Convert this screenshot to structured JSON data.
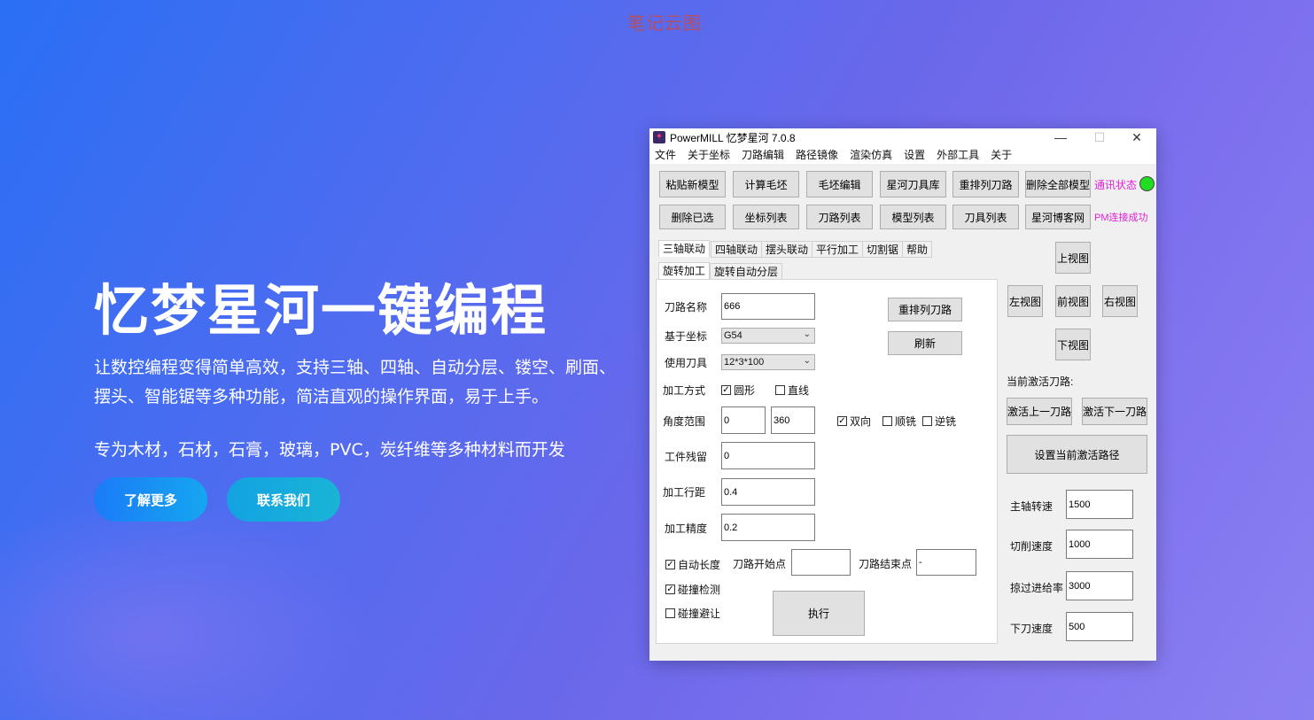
{
  "watermark": "笔记云图",
  "hero": {
    "title": "忆梦星河一键编程",
    "description": "让数控编程变得简单高效，支持三轴、四轴、自动分层、镂空、刷面、摆头、智能锯等多种功能，简洁直观的操作界面，易于上手。",
    "materials": "专为木材，石材，石膏，玻璃，PVC，炭纤维等多种材料而开发",
    "learn_more": "了解更多",
    "contact": "联系我们"
  },
  "window": {
    "title": "PowerMILL 忆梦星河  7.0.8",
    "minimize": "—",
    "maximize": "☐",
    "close": "✕",
    "menu": [
      "文件",
      "关于坐标",
      "刀路编辑",
      "路径镜像",
      "渲染仿真",
      "设置",
      "外部工具",
      "关于"
    ],
    "toolbar_row1": [
      "粘贴新模型",
      "计算毛坯",
      "毛坯编辑",
      "星河刀具库",
      "重排列刀路",
      "删除全部模型"
    ],
    "toolbar_row2": [
      "删除已选",
      "坐标列表",
      "刀路列表",
      "模型列表",
      "刀具列表",
      "星河博客网"
    ],
    "comm_status": "通讯状态",
    "pm_status": "PM连接成功",
    "status_color": "#22dd22",
    "tabs_row1": [
      "三轴联动",
      "四轴联动",
      "摆头联动",
      "平行加工",
      "切割锯",
      "帮助"
    ],
    "tabs_row2": [
      "旋转加工",
      "旋转自动分层"
    ],
    "form": {
      "toolpath_name_label": "刀路名称",
      "toolpath_name": "666",
      "coord_label": "基于坐标",
      "coord_value": "G54",
      "tool_label": "使用刀具",
      "tool_value": "12*3*100",
      "method_label": "加工方式",
      "method_circle": "圆形",
      "method_line": "直线",
      "angle_label": "角度范围",
      "angle_from": "0",
      "angle_to": "360",
      "dir_both": "双向",
      "dir_climb": "顺铣",
      "dir_conv": "逆铣",
      "stock_label": "工件残留",
      "stock_value": "0",
      "stepover_label": "加工行距",
      "stepover_value": "0.4",
      "tolerance_label": "加工精度",
      "tolerance_value": "0.2",
      "auto_length": "自动长度",
      "collision_check": "碰撞检测",
      "collision_avoid": "碰撞避让",
      "start_label": "刀路开始点",
      "start_value": "",
      "end_label": "刀路结束点",
      "end_value": "-",
      "reorder_btn": "重排列刀路",
      "refresh_btn": "刷新",
      "execute_btn": "执行"
    },
    "views": {
      "top": "上视图",
      "left": "左视图",
      "front": "前视图",
      "right": "右视图",
      "bottom": "下视图"
    },
    "active_path_label": "当前激活刀路:",
    "prev_path": "激活上一刀路",
    "next_path": "激活下一刀路",
    "set_active": "设置当前激活路径",
    "params": {
      "spindle_label": "主轴转速",
      "spindle": "1500",
      "cut_label": "切削速度",
      "cut": "1000",
      "feed_label": "掠过进给率",
      "feed": "3000",
      "plunge_label": "下刀速度",
      "plunge": "500"
    }
  }
}
